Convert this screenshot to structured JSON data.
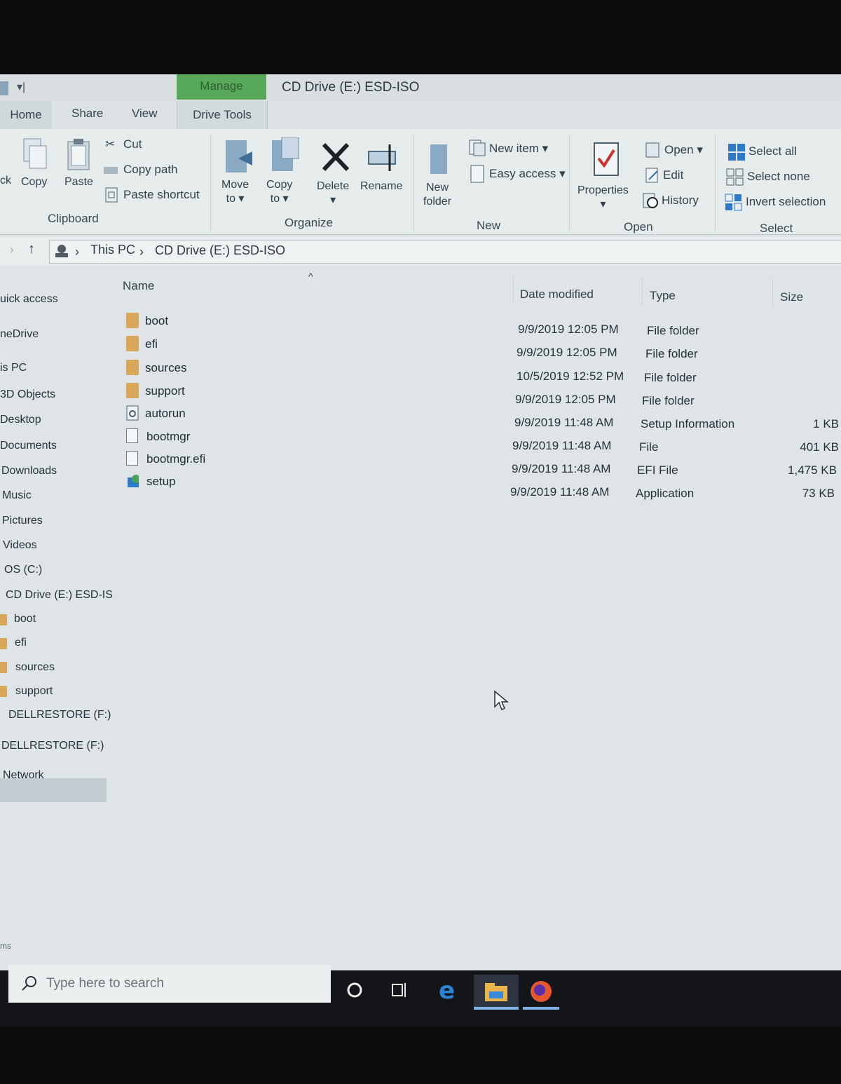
{
  "window": {
    "title": "CD Drive (E:) ESD-ISO",
    "context_tab": "Manage"
  },
  "tabs": [
    "Home",
    "Share",
    "View",
    "Drive Tools"
  ],
  "ribbon": {
    "clipboard": {
      "label": "Clipboard",
      "pin_partial": "ck",
      "copy": "Copy",
      "paste": "Paste",
      "cut": "Cut",
      "copy_path": "Copy path",
      "paste_shortcut": "Paste shortcut"
    },
    "organize": {
      "label": "Organize",
      "move_to_1": "Move",
      "move_to_2": "to",
      "copy_to_1": "Copy",
      "copy_to_2": "to",
      "delete": "Delete",
      "rename": "Rename"
    },
    "new": {
      "label": "New",
      "new_folder_1": "New",
      "new_folder_2": "folder",
      "new_item": "New item",
      "easy_access": "Easy access"
    },
    "open": {
      "label": "Open",
      "properties": "Properties",
      "open": "Open",
      "edit": "Edit",
      "history": "History"
    },
    "select": {
      "label": "Select",
      "select_all": "Select all",
      "select_none": "Select none",
      "invert_selection": "Invert selection"
    }
  },
  "address": {
    "crumbs": [
      "This PC",
      "CD Drive (E:) ESD-ISO"
    ]
  },
  "nav": {
    "items": [
      "uick access",
      "neDrive",
      "is PC",
      "3D Objects",
      "Desktop",
      "Documents",
      "Downloads",
      "Music",
      "Pictures",
      "Videos",
      "OS (C:)",
      "CD Drive (E:) ESD-IS",
      "boot",
      "efi",
      "sources",
      "support",
      "DELLRESTORE (F:)",
      "DELLRESTORE (F:)",
      "Network"
    ],
    "bottom_partial": "ms"
  },
  "columns": {
    "name": "Name",
    "date": "Date modified",
    "type": "Type",
    "size": "Size"
  },
  "files": [
    {
      "name": "boot",
      "date": "9/9/2019 12:05 PM",
      "type": "File folder",
      "size": "",
      "icon": "folder-icon"
    },
    {
      "name": "efi",
      "date": "9/9/2019 12:05 PM",
      "type": "File folder",
      "size": "",
      "icon": "folder-icon"
    },
    {
      "name": "sources",
      "date": "10/5/2019 12:52 PM",
      "type": "File folder",
      "size": "",
      "icon": "folder-icon"
    },
    {
      "name": "support",
      "date": "9/9/2019 12:05 PM",
      "type": "File folder",
      "size": "",
      "icon": "folder-icon"
    },
    {
      "name": "autorun",
      "date": "9/9/2019 11:48 AM",
      "type": "Setup Information",
      "size": "1 KB",
      "icon": "setup-info-icon"
    },
    {
      "name": "bootmgr",
      "date": "9/9/2019 11:48 AM",
      "type": "File",
      "size": "401 KB",
      "icon": "file-icon"
    },
    {
      "name": "bootmgr.efi",
      "date": "9/9/2019 11:48 AM",
      "type": "EFI File",
      "size": "1,475 KB",
      "icon": "file-icon"
    },
    {
      "name": "setup",
      "date": "9/9/2019 11:48 AM",
      "type": "Application",
      "size": "73 KB",
      "icon": "setup-app-icon"
    }
  ],
  "taskbar": {
    "search_placeholder": "Type here to search"
  },
  "colors": {
    "manage_tab": "#58a95a",
    "folder": "#d8a85a",
    "selection": "#c3ccd0",
    "taskbar": "#141518"
  }
}
